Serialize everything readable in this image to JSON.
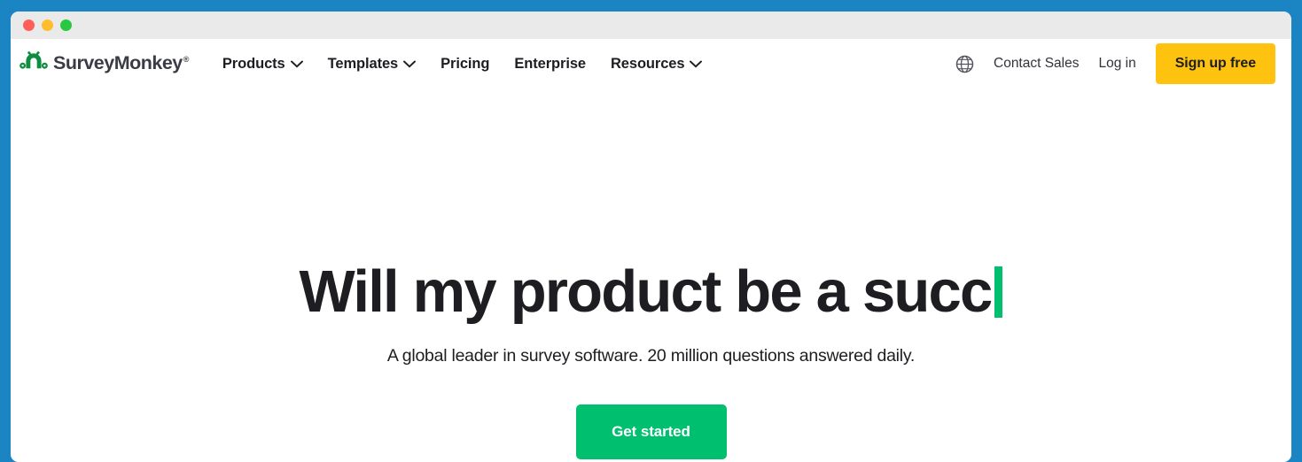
{
  "window": {
    "controls": [
      {
        "name": "close",
        "color": "#ff5f57"
      },
      {
        "name": "minimize",
        "color": "#ffbd2e"
      },
      {
        "name": "maximize",
        "color": "#28c840"
      }
    ]
  },
  "nav": {
    "brand": {
      "name": "SurveyMonkey",
      "registered_mark": "®",
      "logo_color": "#0f8c3f"
    },
    "links": [
      {
        "label": "Products",
        "has_dropdown": true
      },
      {
        "label": "Templates",
        "has_dropdown": true
      },
      {
        "label": "Pricing",
        "has_dropdown": false
      },
      {
        "label": "Enterprise",
        "has_dropdown": false
      },
      {
        "label": "Resources",
        "has_dropdown": true
      }
    ],
    "language_icon": "globe-icon",
    "contact_sales": "Contact Sales",
    "log_in": "Log in",
    "sign_up": "Sign up free"
  },
  "hero": {
    "headline": "Will my product be a succ",
    "cursor_color": "#00bf6f",
    "subtitle": "A global leader in survey software. 20 million questions answered daily.",
    "cta": "Get started"
  },
  "colors": {
    "desktop_background": "#1b85c3",
    "titlebar": "#eaeaea",
    "accent_green": "#00bf6f",
    "accent_yellow": "#ffc20e",
    "text_dark": "#1e1e22"
  }
}
